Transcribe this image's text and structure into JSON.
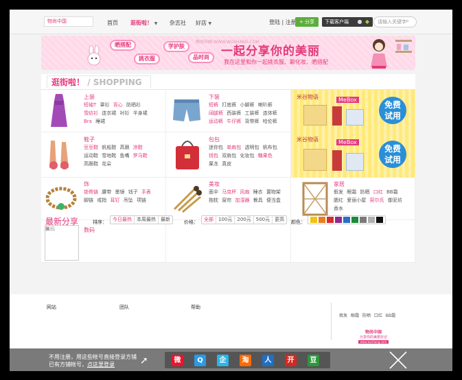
{
  "header": {
    "logo": "物尚中国",
    "nav": [
      {
        "label": "首页"
      },
      {
        "label": "逛街啦！"
      },
      {
        "label": "杂志社"
      },
      {
        "label": "好店"
      }
    ],
    "login": "登陆",
    "sep": "|",
    "register": "注册",
    "share_label": "+ 分享",
    "download_label": "下载客户端",
    "search_placeholder": "请输入关键字"
  },
  "banner": {
    "bubbles": [
      "晒搭配",
      "挑衣服",
      "学护肤",
      "品时尚"
    ],
    "title": "一起分享你的美丽",
    "subtitle": "我在这里和你一起挑衣服、聊化妆、晒搭配",
    "watermark": "物尚中国 WWW.WUSHANG.COM"
  },
  "shopping": {
    "tab_cn": "逛街啦！",
    "tab_en": "/ SHOPPING",
    "categories": [
      {
        "title": "上装",
        "rows": [
          [
            {
              "t": "短袖T",
              "p": true
            },
            {
              "t": "罩衫"
            },
            {
              "t": "背心",
              "p": true
            },
            {
              "t": "防晒衫"
            }
          ],
          [
            {
              "t": "雪纺衫",
              "p": true
            },
            {
              "t": "连衣裙"
            },
            {
              "t": "衬衫"
            },
            {
              "t": "半身裙"
            }
          ],
          [
            {
              "t": "Bra",
              "p": true
            },
            {
              "t": "睡裙"
            }
          ]
        ]
      },
      {
        "title": "下装",
        "rows": [
          [
            {
              "t": "短裤",
              "p": true
            },
            {
              "t": "打底裤"
            },
            {
              "t": "小脚裤"
            },
            {
              "t": "喇叭裤"
            }
          ],
          [
            {
              "t": "阔腿裤",
              "p": true
            },
            {
              "t": "西装裤"
            },
            {
              "t": "工装裤"
            },
            {
              "t": "连体裤"
            }
          ],
          [
            {
              "t": "运动裤",
              "p": true
            },
            {
              "t": "牛仔裤",
              "p": true
            },
            {
              "t": "背带裤"
            },
            {
              "t": "哈伦裤"
            }
          ]
        ]
      },
      {
        "title": "鞋子",
        "rows": [
          [
            {
              "t": "豆豆鞋",
              "p": true
            },
            {
              "t": "帆船鞋"
            },
            {
              "t": "高跟"
            },
            {
              "t": "凉鞋",
              "p": true
            }
          ],
          [
            {
              "t": "运动鞋"
            },
            {
              "t": "雪地靴"
            },
            {
              "t": "鱼嘴"
            },
            {
              "t": "罗马鞋",
              "p": true
            }
          ],
          [
            {
              "t": "高跟鞋"
            },
            {
              "t": "花朵"
            }
          ]
        ]
      },
      {
        "title": "包包",
        "rows": [
          [
            {
              "t": "迷你包"
            },
            {
              "t": "单肩包",
              "p": true
            },
            {
              "t": "透明包"
            },
            {
              "t": "帆布包"
            }
          ],
          [
            {
              "t": "钱包",
              "p": true
            },
            {
              "t": "双肩包"
            },
            {
              "t": "化妆包"
            },
            {
              "t": "糖果色",
              "p": true
            }
          ],
          [
            {
              "t": "果冻"
            },
            {
              "t": "真皮"
            }
          ]
        ]
      },
      {
        "title": "饰",
        "rows": [
          [
            {
              "t": "锁骨链",
              "p": true
            },
            {
              "t": "腰带"
            },
            {
              "t": "墨镜"
            },
            {
              "t": "钱子"
            },
            {
              "t": "手表",
              "p": true
            }
          ],
          [
            {
              "t": "脚链"
            },
            {
              "t": "戒指"
            },
            {
              "t": "耳钉",
              "p": true
            },
            {
              "t": "吊坠"
            },
            {
              "t": "项链"
            }
          ]
        ]
      },
      {
        "title": "美妆",
        "rows": [
          [
            {
              "t": "面伞"
            },
            {
              "t": "马克杯",
              "p": true
            },
            {
              "t": "风扇",
              "p": true
            },
            {
              "t": "睡衣"
            },
            {
              "t": "置物架"
            }
          ],
          [
            {
              "t": "抱枕"
            },
            {
              "t": "窗帘"
            },
            {
              "t": "加湿器",
              "p": true
            },
            {
              "t": "餐具"
            },
            {
              "t": "便当盒"
            }
          ]
        ]
      },
      {
        "title": "家居",
        "rows": [
          [
            {
              "t": "假发"
            },
            {
              "t": "眼霜"
            },
            {
              "t": "防晒"
            },
            {
              "t": "口红",
              "p": true
            },
            {
              "t": "BB霜"
            }
          ],
          [
            {
              "t": "腮红"
            },
            {
              "t": "爱丽小屋"
            },
            {
              "t": "契尔氏",
              "p": true
            },
            {
              "t": "御泥坊"
            }
          ],
          [
            {
              "t": "香水"
            }
          ]
        ]
      },
      {
        "title": "数码",
        "rows": []
      }
    ],
    "ads": [
      {
        "brand": "米谷物语",
        "mebox": "MeBox",
        "free_l1": "免费",
        "free_l2": "试用"
      },
      {
        "brand": "米谷物语",
        "mebox": "MeBox",
        "free_l1": "免费",
        "free_l2": "试用"
      }
    ],
    "digital_placeholder": "数码"
  },
  "latest": {
    "title": "最新分享",
    "sort_label": "排序：",
    "sort_options": [
      "今日最热",
      "本周最热",
      "最新"
    ],
    "price_label": "价格：",
    "price_options": [
      "全部",
      "100元",
      "200元",
      "500元",
      "更高"
    ],
    "color_label": "颜色：",
    "colors": [
      "#f1c40f",
      "#e67e22",
      "#d62d2d",
      "#8e2b8e",
      "#2b6fc4",
      "#1f8a3b",
      "#7a7a7a",
      "#b0b0b0",
      "#111111"
    ]
  },
  "footer": {
    "cols": [
      "网站",
      "团队",
      "帮助"
    ],
    "links": [
      "假发",
      "眼霜",
      "防晒",
      "口红",
      "BB霜"
    ],
    "brand_name": "物尚中国",
    "brand_tag": "分享你的美丽日记",
    "brand_url": "www.wushang.com"
  },
  "loginbar": {
    "line1": "不用注册，用这些帐号直接登录方铺",
    "line2_prefix": "已有方铺帐号，",
    "line2_link": "点这里登录",
    "providers": [
      {
        "name": "weibo-icon",
        "glyph": "微",
        "color": "#e6162d"
      },
      {
        "name": "qq-weibo-icon",
        "glyph": "Q",
        "color": "#2a9ae8"
      },
      {
        "name": "qq-icon",
        "glyph": "企",
        "color": "#29b6e8"
      },
      {
        "name": "taobao-icon",
        "glyph": "淘",
        "color": "#ff6a00"
      },
      {
        "name": "renren-icon",
        "glyph": "人",
        "color": "#1f6fc5"
      },
      {
        "name": "kaixin-icon",
        "glyph": "开",
        "color": "#d7261f"
      },
      {
        "name": "douban-icon",
        "glyph": "豆",
        "color": "#2e963d"
      }
    ]
  }
}
